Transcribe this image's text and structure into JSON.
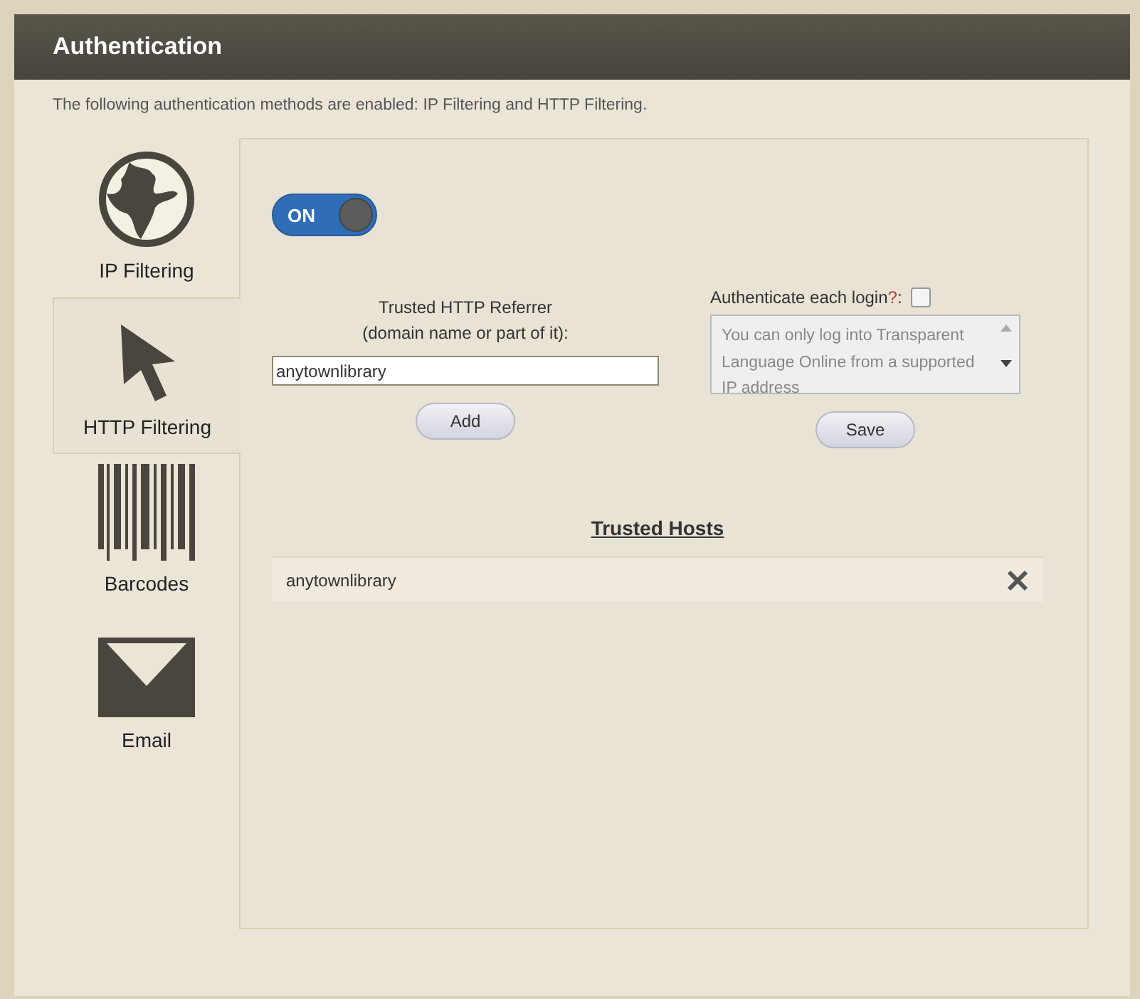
{
  "panel": {
    "title": "Authentication"
  },
  "description": "The following authentication methods are enabled: IP Filtering and HTTP Filtering.",
  "methods": [
    {
      "label": "IP Filtering",
      "kind": "globe",
      "selected": false
    },
    {
      "label": "HTTP Filtering",
      "kind": "cursor",
      "selected": true
    },
    {
      "label": "Barcodes",
      "kind": "barcode",
      "selected": false
    },
    {
      "label": "Email",
      "kind": "envelope",
      "selected": false
    }
  ],
  "toggle": {
    "label": "ON",
    "on": true
  },
  "referrer": {
    "label_lines": [
      "Trusted HTTP Referrer",
      "(domain name or part of it):"
    ],
    "value": "anytownlibrary",
    "button": "Add"
  },
  "login": {
    "label": "Authenticate each login",
    "help": "?",
    "suffix": ":",
    "checked": false,
    "message": "You can only log into Transparent Language Online from a supported IP address",
    "button": "Save"
  },
  "trusted_hosts": {
    "title": "Trusted Hosts",
    "rows": [
      {
        "host": "anytownlibrary"
      }
    ]
  }
}
